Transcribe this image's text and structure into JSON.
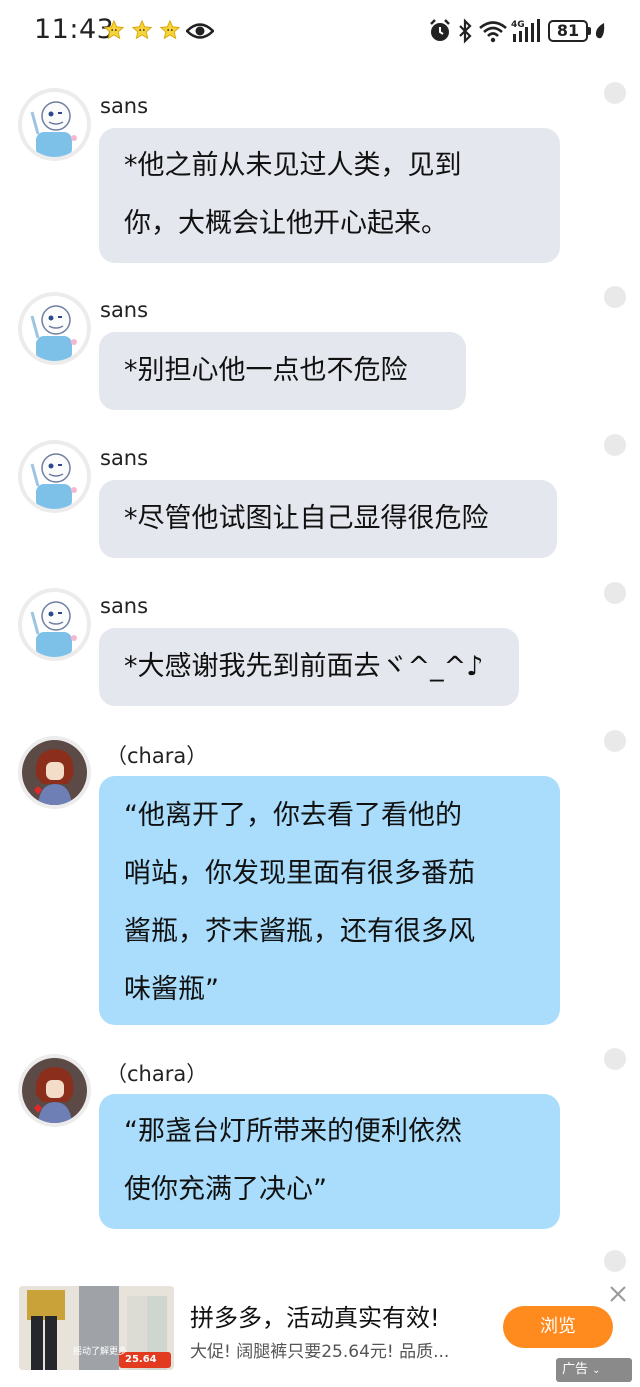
{
  "status_bar": {
    "time": "11:43",
    "battery": "81",
    "network": "4G",
    "icons": [
      "star-icon",
      "star-icon",
      "star-icon",
      "eye-icon",
      "alarm-icon",
      "bluetooth-icon",
      "wifi-icon",
      "signal-icon",
      "battery-icon",
      "leaf-icon"
    ]
  },
  "messages": [
    {
      "sender": "sans",
      "lines": [
        "*他之前从未见过人类，见到",
        "你，大概会让他开心起来。"
      ],
      "style": "gray"
    },
    {
      "sender": "sans",
      "lines": [
        "*别担心他一点也不危险"
      ],
      "style": "gray"
    },
    {
      "sender": "sans",
      "lines": [
        "*尽管他试图让自己显得很危险"
      ],
      "style": "gray"
    },
    {
      "sender": "sans",
      "lines": [
        "*大感谢我先到前面去ヾ^_^♪"
      ],
      "style": "gray"
    },
    {
      "sender": "（chara）",
      "lines": [
        "“他离开了，你去看了看他的",
        "哨站，你发现里面有很多番茄",
        "酱瓶，芥末酱瓶，还有很多风",
        "味酱瓶”"
      ],
      "style": "blue"
    },
    {
      "sender": "（chara）",
      "lines": [
        "“那盏台灯所带来的便利依然",
        "使你充满了决心”"
      ],
      "style": "blue"
    }
  ],
  "ad": {
    "title": "拼多多，活动真实有效!",
    "description": "大促! 阔腿裤只要25.64元! 品质...",
    "button_label": "浏览",
    "tag_label": "广告",
    "thumb_overlay_text": "摇动了解更多",
    "thumb_price": "25.64",
    "colors": {
      "button": "#ff8a1e"
    }
  },
  "colors": {
    "sans_bubble": "#e4e7ed",
    "chara_bubble": "#a9ddfb"
  }
}
